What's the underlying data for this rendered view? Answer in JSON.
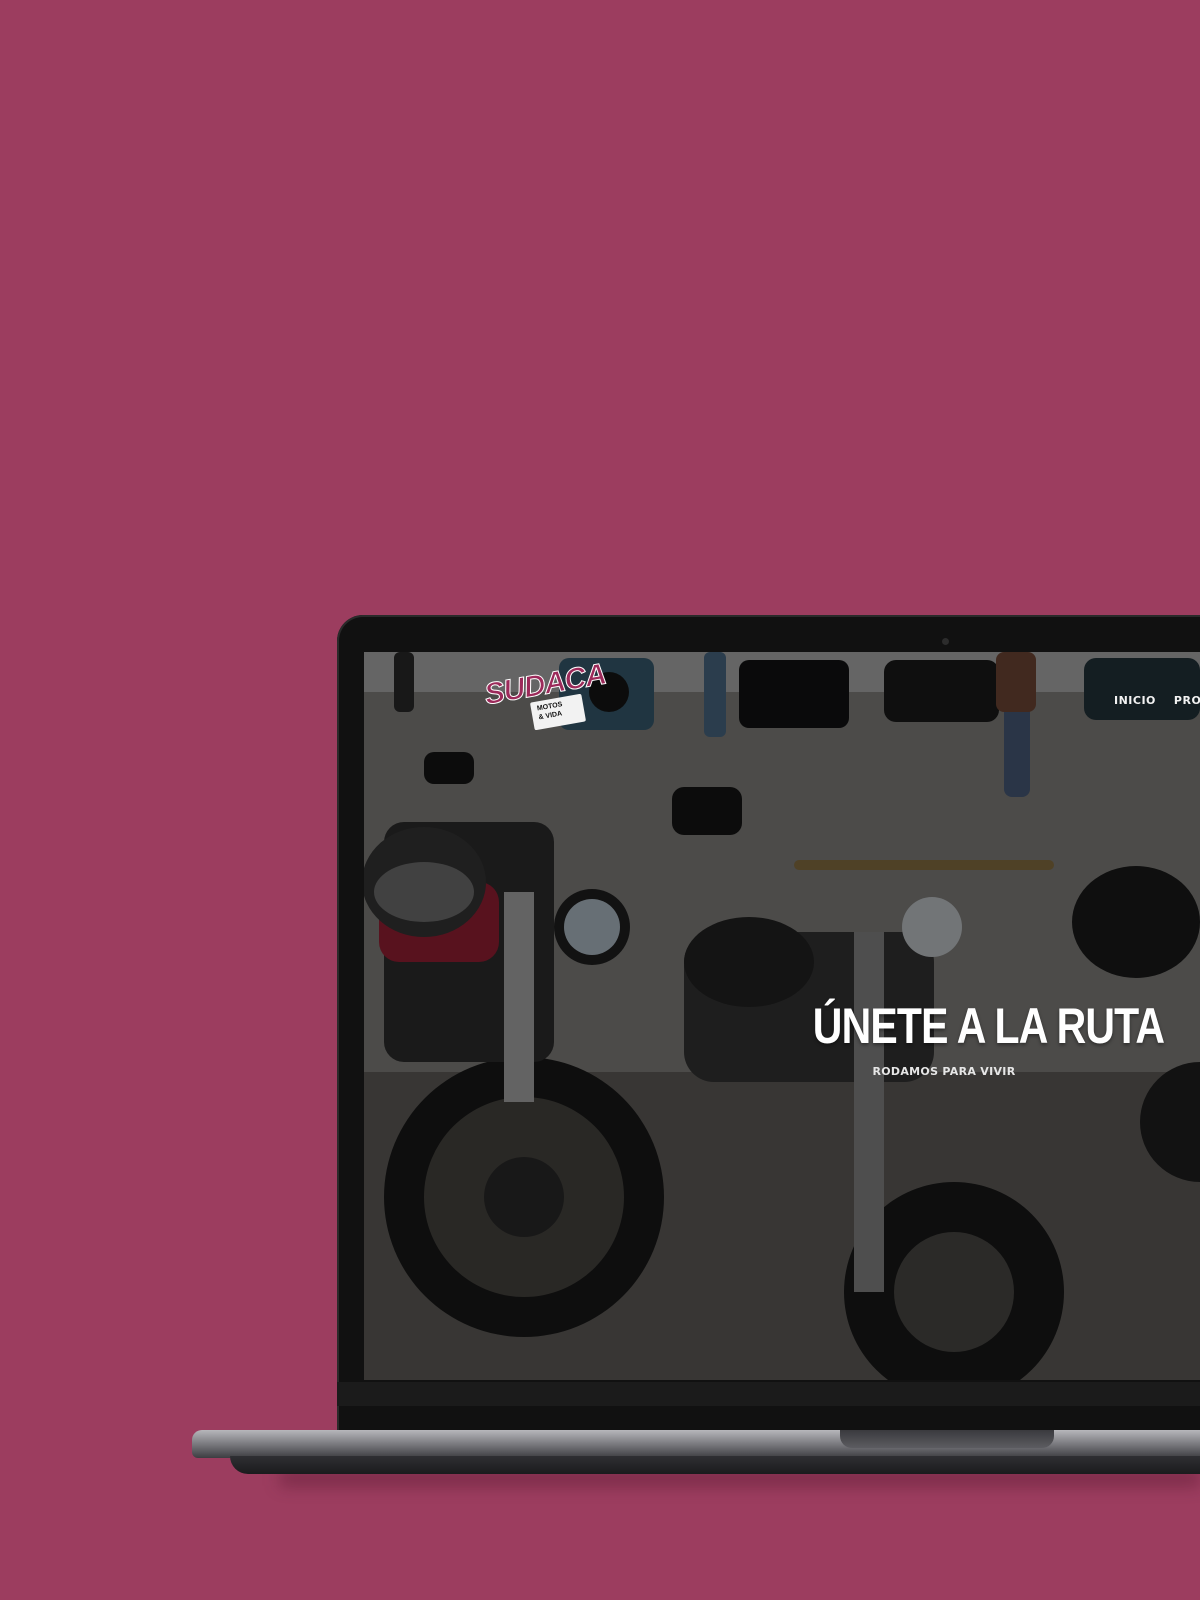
{
  "colors": {
    "background": "#9c3d5f",
    "brand_accent": "#9c2a5a"
  },
  "site": {
    "logo": {
      "name": "SUDACA",
      "tagline_line1": "MOTOS",
      "tagline_line2": "& VIDA"
    },
    "nav": [
      {
        "label": "INICIO"
      },
      {
        "label": "PRODU"
      }
    ],
    "hero": {
      "title": "ÚNETE A LA RUTA",
      "subtitle": "RODAMOS PARA VIVIR",
      "background_image": "motorcycles-in-parking-lot"
    }
  }
}
